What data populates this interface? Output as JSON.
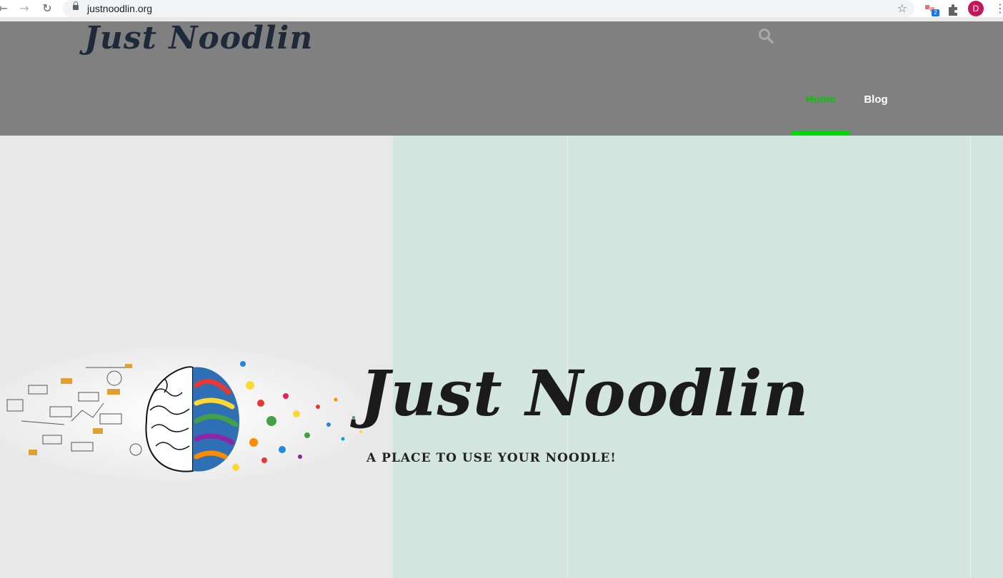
{
  "browser": {
    "url": "justnoodlin.org",
    "extension_badge": "2",
    "profile_initial": "D"
  },
  "site": {
    "logo": "Just Noodlin",
    "nav": {
      "home": "Home",
      "blog": "Blog"
    },
    "colors": {
      "header_bg": "#808080",
      "nav_active": "#00c800",
      "hero_right_bg": "#d2e5df"
    }
  },
  "hero": {
    "title": "Just Noodlin",
    "tagline": "A PLACE TO USE YOUR NOODLE!"
  }
}
